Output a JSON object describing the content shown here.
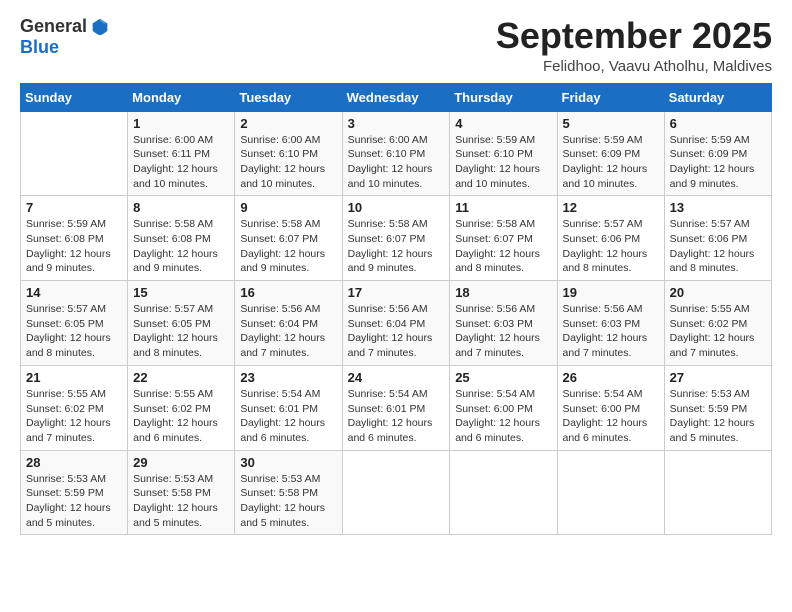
{
  "header": {
    "logo_general": "General",
    "logo_blue": "Blue",
    "month_title": "September 2025",
    "location": "Felidhoo, Vaavu Atholhu, Maldives"
  },
  "days_of_week": [
    "Sunday",
    "Monday",
    "Tuesday",
    "Wednesday",
    "Thursday",
    "Friday",
    "Saturday"
  ],
  "weeks": [
    [
      {
        "day": "",
        "info": ""
      },
      {
        "day": "1",
        "info": "Sunrise: 6:00 AM\nSunset: 6:11 PM\nDaylight: 12 hours\nand 10 minutes."
      },
      {
        "day": "2",
        "info": "Sunrise: 6:00 AM\nSunset: 6:10 PM\nDaylight: 12 hours\nand 10 minutes."
      },
      {
        "day": "3",
        "info": "Sunrise: 6:00 AM\nSunset: 6:10 PM\nDaylight: 12 hours\nand 10 minutes."
      },
      {
        "day": "4",
        "info": "Sunrise: 5:59 AM\nSunset: 6:10 PM\nDaylight: 12 hours\nand 10 minutes."
      },
      {
        "day": "5",
        "info": "Sunrise: 5:59 AM\nSunset: 6:09 PM\nDaylight: 12 hours\nand 10 minutes."
      },
      {
        "day": "6",
        "info": "Sunrise: 5:59 AM\nSunset: 6:09 PM\nDaylight: 12 hours\nand 9 minutes."
      }
    ],
    [
      {
        "day": "7",
        "info": "Sunrise: 5:59 AM\nSunset: 6:08 PM\nDaylight: 12 hours\nand 9 minutes."
      },
      {
        "day": "8",
        "info": "Sunrise: 5:58 AM\nSunset: 6:08 PM\nDaylight: 12 hours\nand 9 minutes."
      },
      {
        "day": "9",
        "info": "Sunrise: 5:58 AM\nSunset: 6:07 PM\nDaylight: 12 hours\nand 9 minutes."
      },
      {
        "day": "10",
        "info": "Sunrise: 5:58 AM\nSunset: 6:07 PM\nDaylight: 12 hours\nand 9 minutes."
      },
      {
        "day": "11",
        "info": "Sunrise: 5:58 AM\nSunset: 6:07 PM\nDaylight: 12 hours\nand 8 minutes."
      },
      {
        "day": "12",
        "info": "Sunrise: 5:57 AM\nSunset: 6:06 PM\nDaylight: 12 hours\nand 8 minutes."
      },
      {
        "day": "13",
        "info": "Sunrise: 5:57 AM\nSunset: 6:06 PM\nDaylight: 12 hours\nand 8 minutes."
      }
    ],
    [
      {
        "day": "14",
        "info": "Sunrise: 5:57 AM\nSunset: 6:05 PM\nDaylight: 12 hours\nand 8 minutes."
      },
      {
        "day": "15",
        "info": "Sunrise: 5:57 AM\nSunset: 6:05 PM\nDaylight: 12 hours\nand 8 minutes."
      },
      {
        "day": "16",
        "info": "Sunrise: 5:56 AM\nSunset: 6:04 PM\nDaylight: 12 hours\nand 7 minutes."
      },
      {
        "day": "17",
        "info": "Sunrise: 5:56 AM\nSunset: 6:04 PM\nDaylight: 12 hours\nand 7 minutes."
      },
      {
        "day": "18",
        "info": "Sunrise: 5:56 AM\nSunset: 6:03 PM\nDaylight: 12 hours\nand 7 minutes."
      },
      {
        "day": "19",
        "info": "Sunrise: 5:56 AM\nSunset: 6:03 PM\nDaylight: 12 hours\nand 7 minutes."
      },
      {
        "day": "20",
        "info": "Sunrise: 5:55 AM\nSunset: 6:02 PM\nDaylight: 12 hours\nand 7 minutes."
      }
    ],
    [
      {
        "day": "21",
        "info": "Sunrise: 5:55 AM\nSunset: 6:02 PM\nDaylight: 12 hours\nand 7 minutes."
      },
      {
        "day": "22",
        "info": "Sunrise: 5:55 AM\nSunset: 6:02 PM\nDaylight: 12 hours\nand 6 minutes."
      },
      {
        "day": "23",
        "info": "Sunrise: 5:54 AM\nSunset: 6:01 PM\nDaylight: 12 hours\nand 6 minutes."
      },
      {
        "day": "24",
        "info": "Sunrise: 5:54 AM\nSunset: 6:01 PM\nDaylight: 12 hours\nand 6 minutes."
      },
      {
        "day": "25",
        "info": "Sunrise: 5:54 AM\nSunset: 6:00 PM\nDaylight: 12 hours\nand 6 minutes."
      },
      {
        "day": "26",
        "info": "Sunrise: 5:54 AM\nSunset: 6:00 PM\nDaylight: 12 hours\nand 6 minutes."
      },
      {
        "day": "27",
        "info": "Sunrise: 5:53 AM\nSunset: 5:59 PM\nDaylight: 12 hours\nand 5 minutes."
      }
    ],
    [
      {
        "day": "28",
        "info": "Sunrise: 5:53 AM\nSunset: 5:59 PM\nDaylight: 12 hours\nand 5 minutes."
      },
      {
        "day": "29",
        "info": "Sunrise: 5:53 AM\nSunset: 5:58 PM\nDaylight: 12 hours\nand 5 minutes."
      },
      {
        "day": "30",
        "info": "Sunrise: 5:53 AM\nSunset: 5:58 PM\nDaylight: 12 hours\nand 5 minutes."
      },
      {
        "day": "",
        "info": ""
      },
      {
        "day": "",
        "info": ""
      },
      {
        "day": "",
        "info": ""
      },
      {
        "day": "",
        "info": ""
      }
    ]
  ]
}
